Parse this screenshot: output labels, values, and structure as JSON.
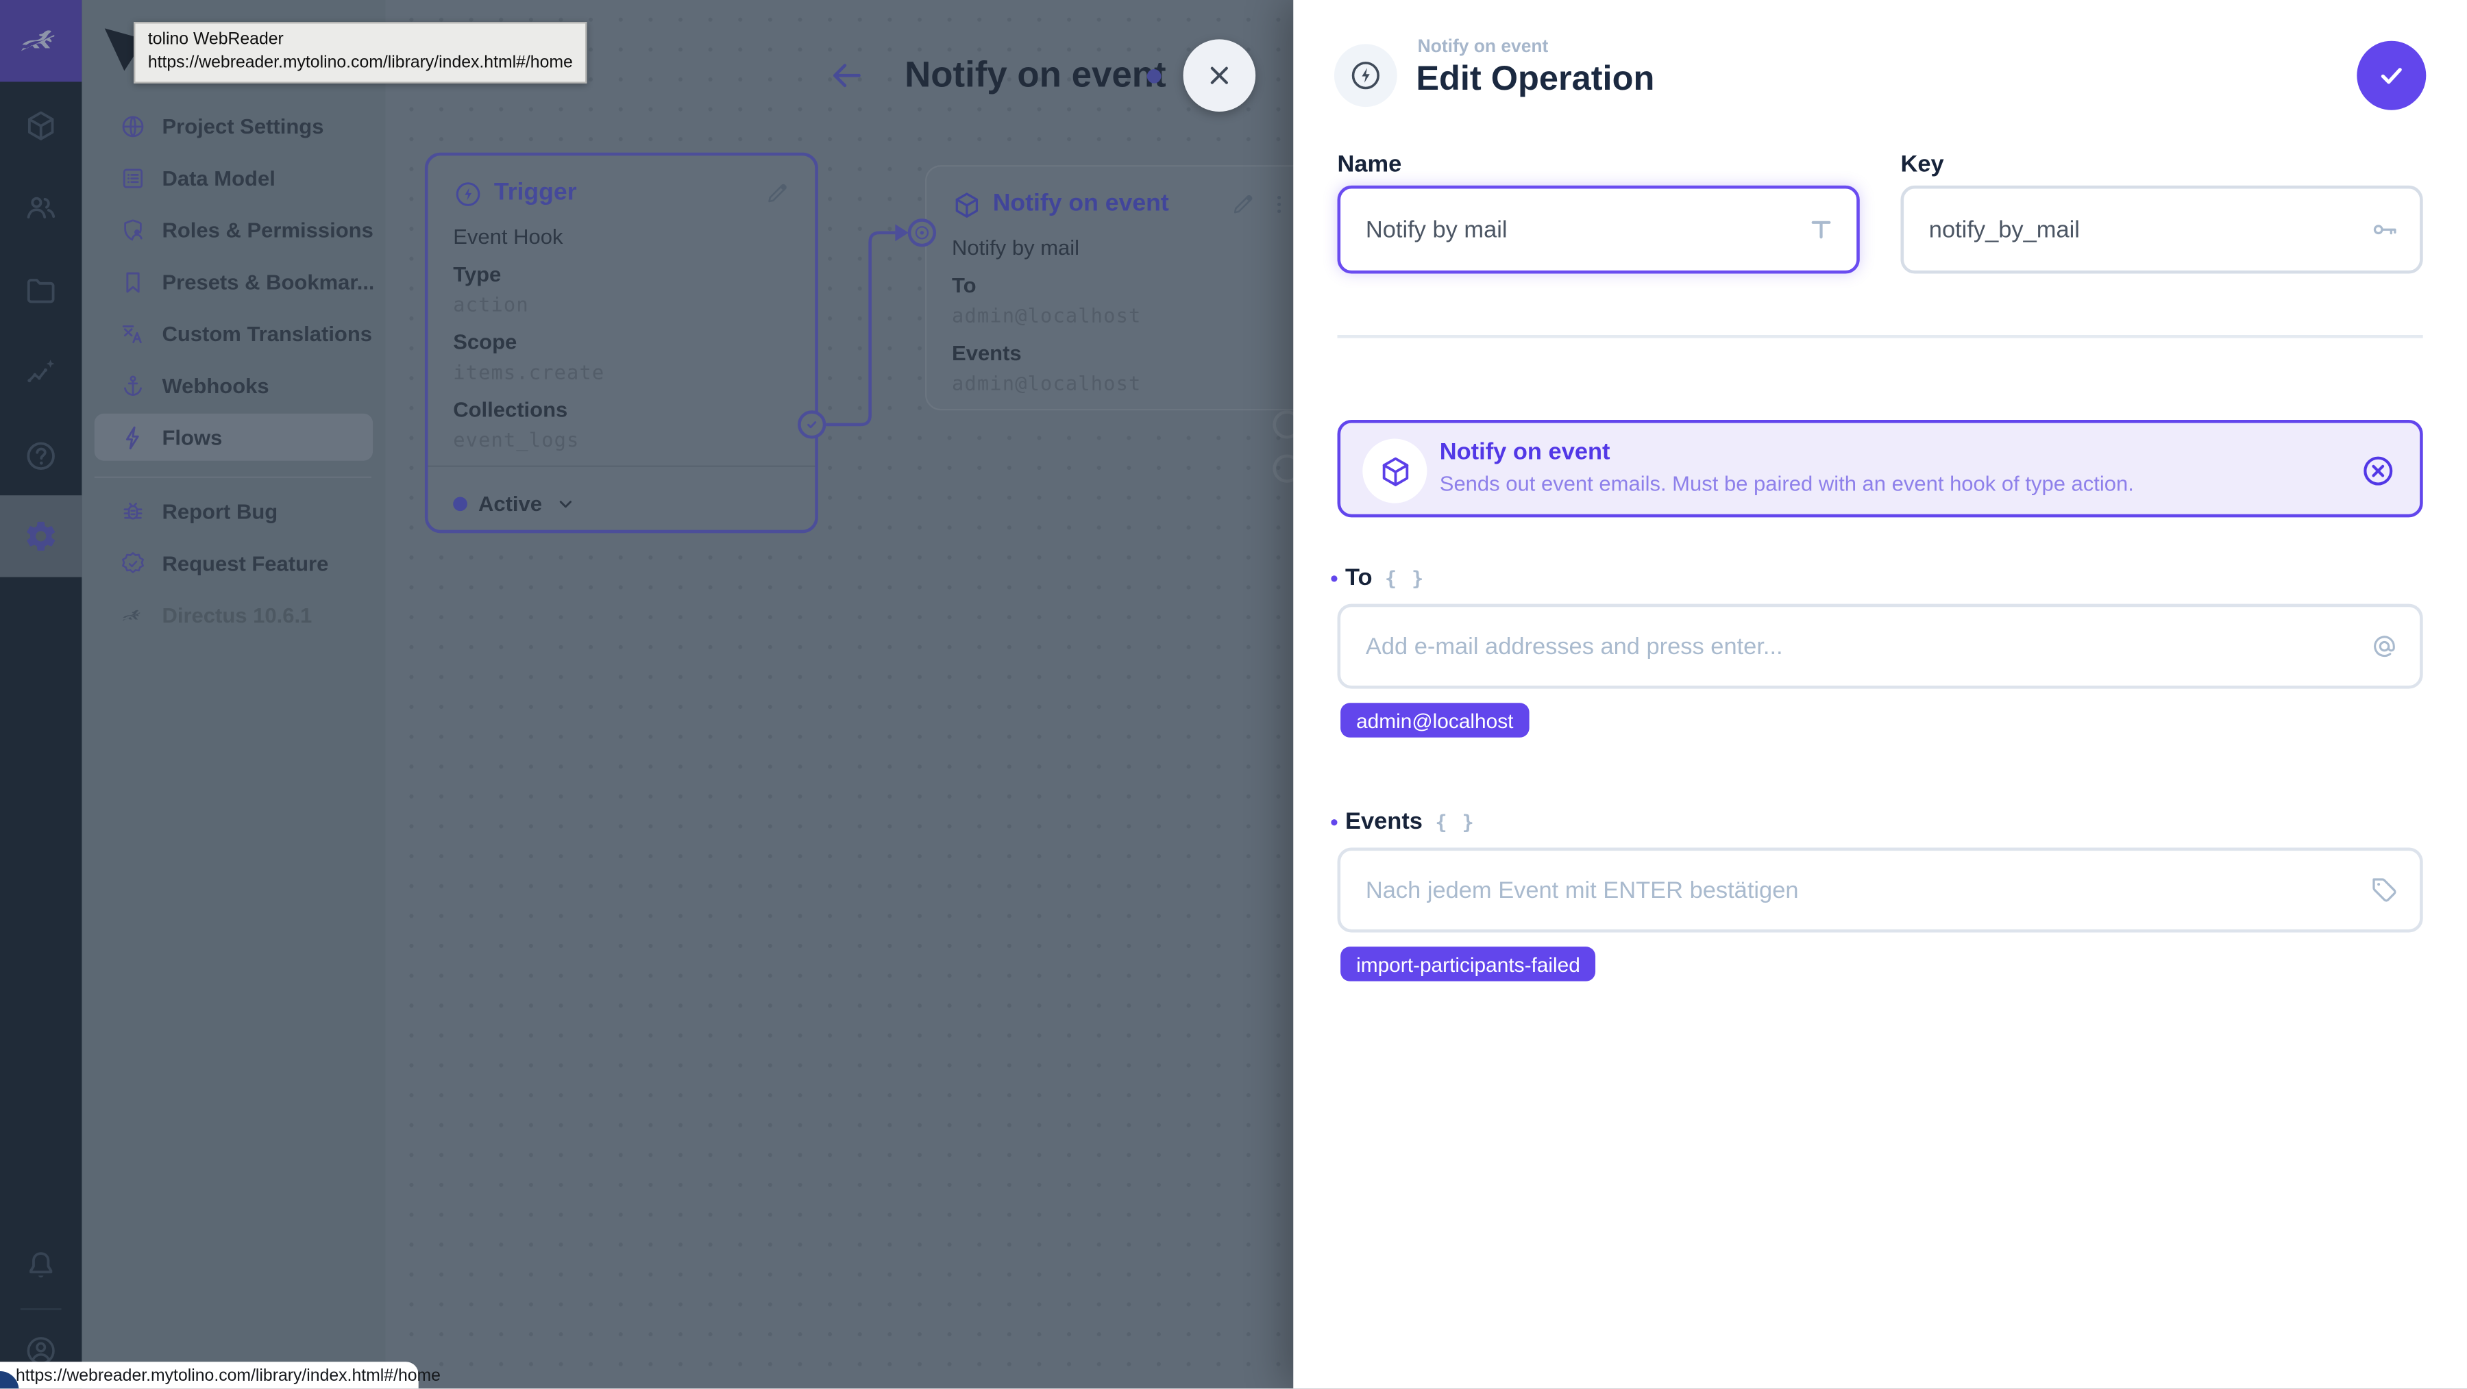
{
  "app": {
    "accent": "#6246ec",
    "dim_purple": "#45499b"
  },
  "tooltip": {
    "title": "tolino WebReader",
    "url": "https://webreader.mytolino.com/library/index.html#/home"
  },
  "status_bar": {
    "url": "https://webreader.mytolino.com/library/index.html#/home"
  },
  "module_bar": {
    "modules": [
      "directus-logo",
      "content",
      "users",
      "files",
      "insights",
      "help",
      "settings"
    ],
    "active": "settings",
    "bottom": [
      "notifications",
      "account"
    ]
  },
  "sidebar": {
    "items": [
      {
        "label": "Project Settings",
        "icon": "globe-icon"
      },
      {
        "label": "Data Model",
        "icon": "data-model-icon"
      },
      {
        "label": "Roles & Permissions",
        "icon": "shield-user-icon"
      },
      {
        "label": "Presets & Bookmar...",
        "icon": "bookmark-icon"
      },
      {
        "label": "Custom Translations",
        "icon": "translate-icon"
      },
      {
        "label": "Webhooks",
        "icon": "anchor-icon"
      },
      {
        "label": "Flows",
        "icon": "bolt-icon",
        "active": true
      }
    ],
    "footer": [
      {
        "label": "Report Bug",
        "icon": "bug-icon"
      },
      {
        "label": "Request Feature",
        "icon": "badge-check-icon"
      }
    ],
    "version": "Directus 10.6.1"
  },
  "canvas": {
    "title": "Notify on event",
    "trigger": {
      "title": "Trigger",
      "subtitle": "Event Hook",
      "fields": [
        {
          "label": "Type",
          "value": "action"
        },
        {
          "label": "Scope",
          "value": "items.create"
        },
        {
          "label": "Collections",
          "value": "event_logs"
        }
      ],
      "status": "Active"
    },
    "operation": {
      "title": "Notify on event",
      "name": "Notify by mail",
      "fields": [
        {
          "label": "To",
          "value": "admin@localhost"
        },
        {
          "label": "Events",
          "value": "admin@localhost"
        }
      ]
    }
  },
  "drawer": {
    "breadcrumb": "Notify on event",
    "title": "Edit Operation",
    "name": {
      "label": "Name",
      "value": "Notify by mail"
    },
    "key": {
      "label": "Key",
      "value": "notify_by_mail"
    },
    "info": {
      "title": "Notify on event",
      "description": "Sends out event emails. Must be paired with an event hook of type action."
    },
    "to": {
      "label": "To",
      "placeholder": "Add e-mail addresses and press enter...",
      "chips": [
        "admin@localhost"
      ]
    },
    "events": {
      "label": "Events",
      "placeholder": "Nach jedem Event mit ENTER bestätigen",
      "chips": [
        "import-participants-failed"
      ]
    }
  }
}
